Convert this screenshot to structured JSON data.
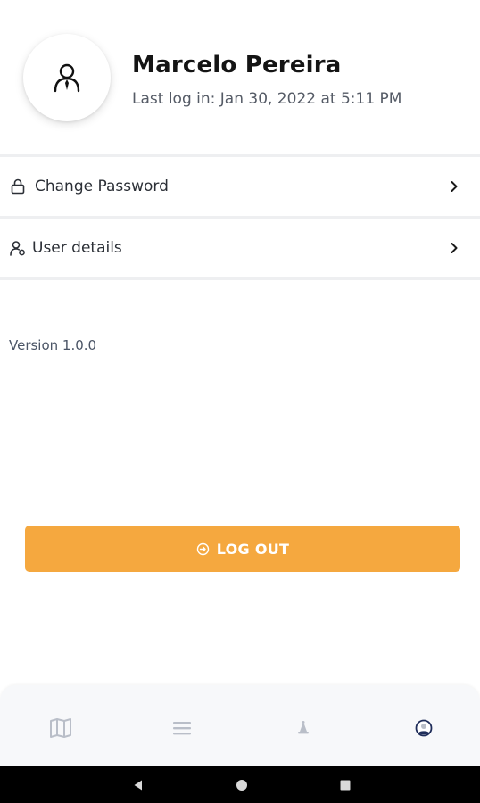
{
  "profile": {
    "name": "Marcelo Pereira",
    "last_login": "Last log in: Jan 30, 2022 at 5:11 PM",
    "avatar_icon": "user-icon"
  },
  "menu": [
    {
      "label": "Change Password",
      "icon": "lock-icon"
    },
    {
      "label": "User details",
      "icon": "user-settings-icon"
    }
  ],
  "version": "Version 1.0.0",
  "logout": {
    "label": "LOG OUT",
    "icon": "logout-icon",
    "color": "#f5a83f"
  },
  "bottom_nav": {
    "items": [
      {
        "icon": "map-icon",
        "active": false
      },
      {
        "icon": "list-icon",
        "active": false
      },
      {
        "icon": "bell-icon",
        "active": false
      },
      {
        "icon": "profile-icon",
        "active": true
      }
    ],
    "active_color": "#1f2d5a",
    "inactive_color": "#b9bec8"
  },
  "system_nav": [
    "back-icon",
    "home-icon",
    "recents-icon"
  ]
}
